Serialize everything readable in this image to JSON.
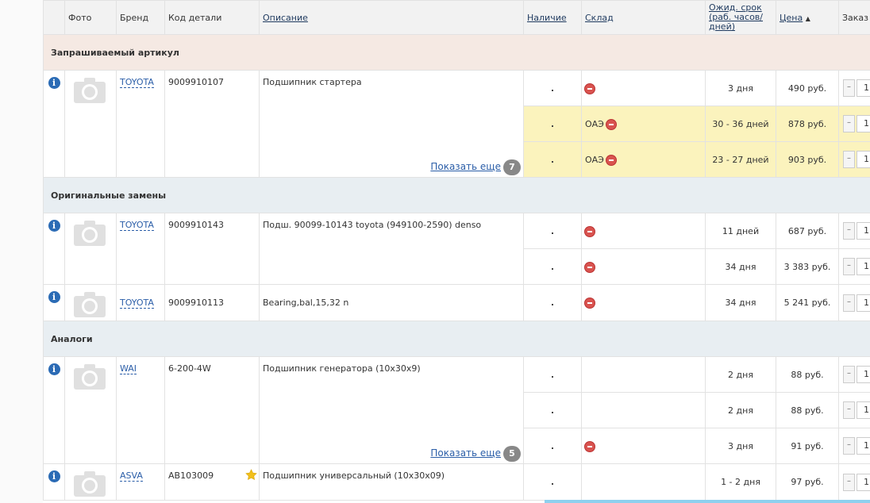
{
  "header": {
    "photo": "Фото",
    "brand": "Бренд",
    "code": "Код детали",
    "description": "Описание",
    "availability": "Наличие",
    "warehouse": "Склад",
    "expected": "Ожид. срок (раб. часов/ дней)",
    "price": "Цена",
    "price_sort": "▲",
    "order": "Заказ"
  },
  "sections": {
    "requested": "Запрашиваемый артикул",
    "originals": "Оригинальные замены",
    "analogs": "Аналоги"
  },
  "show_more_label": "Показать еще",
  "info_glyph": "i",
  "icons": {
    "info": "info-icon",
    "photo": "camera-icon",
    "stop": "stop-icon",
    "star": "star-icon"
  },
  "colors": {
    "pink_section": "#f5e9e3",
    "grey_section": "#e8eef2",
    "yellow_row": "#fbf3bd",
    "info": "#2b6bb5",
    "link": "#2b5ea8"
  },
  "requested": {
    "brand": "TOYOTA",
    "code": "9009910107",
    "description": "Подшипник стартера",
    "more_count": "7",
    "offers": [
      {
        "warehouse": "",
        "term": "3 дня",
        "price": "490 руб.",
        "qty": "1"
      },
      {
        "warehouse": "ОАЭ",
        "term": "30 - 36 дней",
        "price": "878 руб.",
        "qty": "1"
      },
      {
        "warehouse": "ОАЭ",
        "term": "23 - 27 дней",
        "price": "903 руб.",
        "qty": "1"
      }
    ]
  },
  "originals": [
    {
      "brand": "TOYOTA",
      "code": "9009910143",
      "description": "Подш. 90099-10143 toyota (949100-2590) denso",
      "offers": [
        {
          "term": "11 дней",
          "price": "687 руб.",
          "qty": "1"
        },
        {
          "term": "34 дня",
          "price": "3 383 руб.",
          "qty": "1"
        }
      ]
    },
    {
      "brand": "TOYOTA",
      "code": "9009910113",
      "description": "Bearing,bal,15,32 n",
      "offers": [
        {
          "term": "34 дня",
          "price": "5 241 руб.",
          "qty": "1"
        }
      ]
    }
  ],
  "analogs": [
    {
      "brand": "WAI",
      "code": "6-200-4W",
      "description": "Подшипник генератора (10x30x9)",
      "more_count": "5",
      "offers": [
        {
          "term": "2 дня",
          "price": "88 руб.",
          "qty": "1"
        },
        {
          "term": "2 дня",
          "price": "88 руб.",
          "qty": "1"
        },
        {
          "term": "3 дня",
          "price": "91 руб.",
          "qty": "1"
        }
      ]
    },
    {
      "brand": "ASVA",
      "code": "AB103009",
      "description": "Подшипник универсальный (10x30x09)",
      "offers": [
        {
          "term": "1 - 2 дня",
          "price": "97 руб.",
          "qty": "1"
        }
      ]
    }
  ],
  "qty_minus": "–"
}
